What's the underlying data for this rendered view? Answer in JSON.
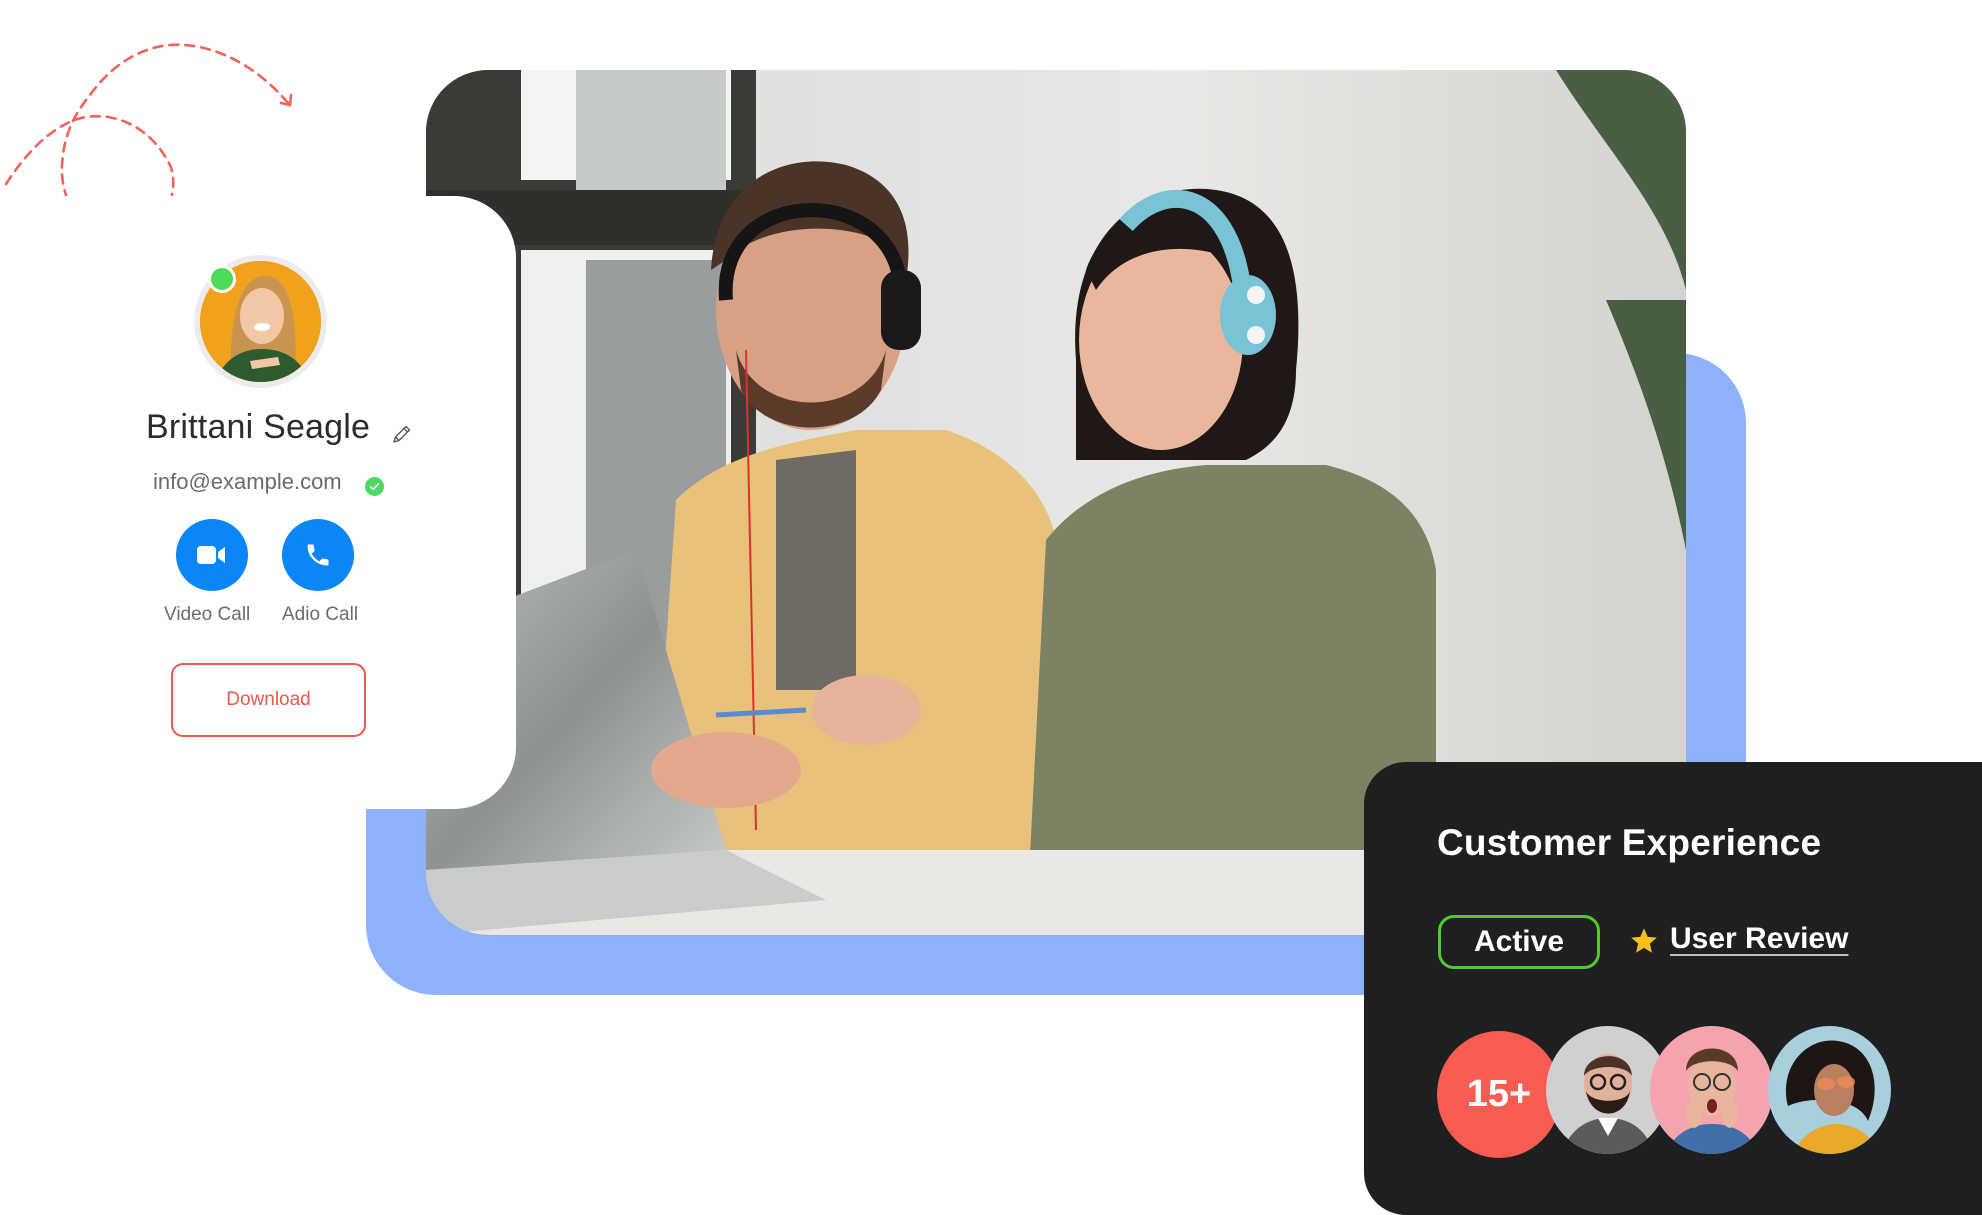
{
  "profile": {
    "name": "Brittani Seagle",
    "email": "info@example.com",
    "status": "online",
    "email_verified": true,
    "actions": [
      {
        "id": "video",
        "label": "Video Call",
        "icon": "video-camera-icon"
      },
      {
        "id": "audio",
        "label": "Adio Call",
        "icon": "phone-icon"
      }
    ],
    "download_label": "Download",
    "edit_icon": "pencil-icon"
  },
  "experience_card": {
    "title": "Customer Experience",
    "badge": "Active",
    "review_icon": "star-icon",
    "review_label": "User Review",
    "count_label": "15+",
    "reviewer_avatars": [
      "bearded-man-glasses",
      "surprised-man-glasses",
      "curly-hair-woman-sunglasses"
    ]
  },
  "hero_photo": {
    "subject": "two people wearing headsets working at a laptop"
  },
  "colors": {
    "accent_blue": "#0b86f6",
    "frame_blue": "#8db2fb",
    "download_red": "#e9594f",
    "active_green": "#4fcb2f",
    "count_red": "#f85b51",
    "dark_card": "#1e1f21",
    "star_yellow": "#f7c11b",
    "online_green": "#4cdc55"
  }
}
